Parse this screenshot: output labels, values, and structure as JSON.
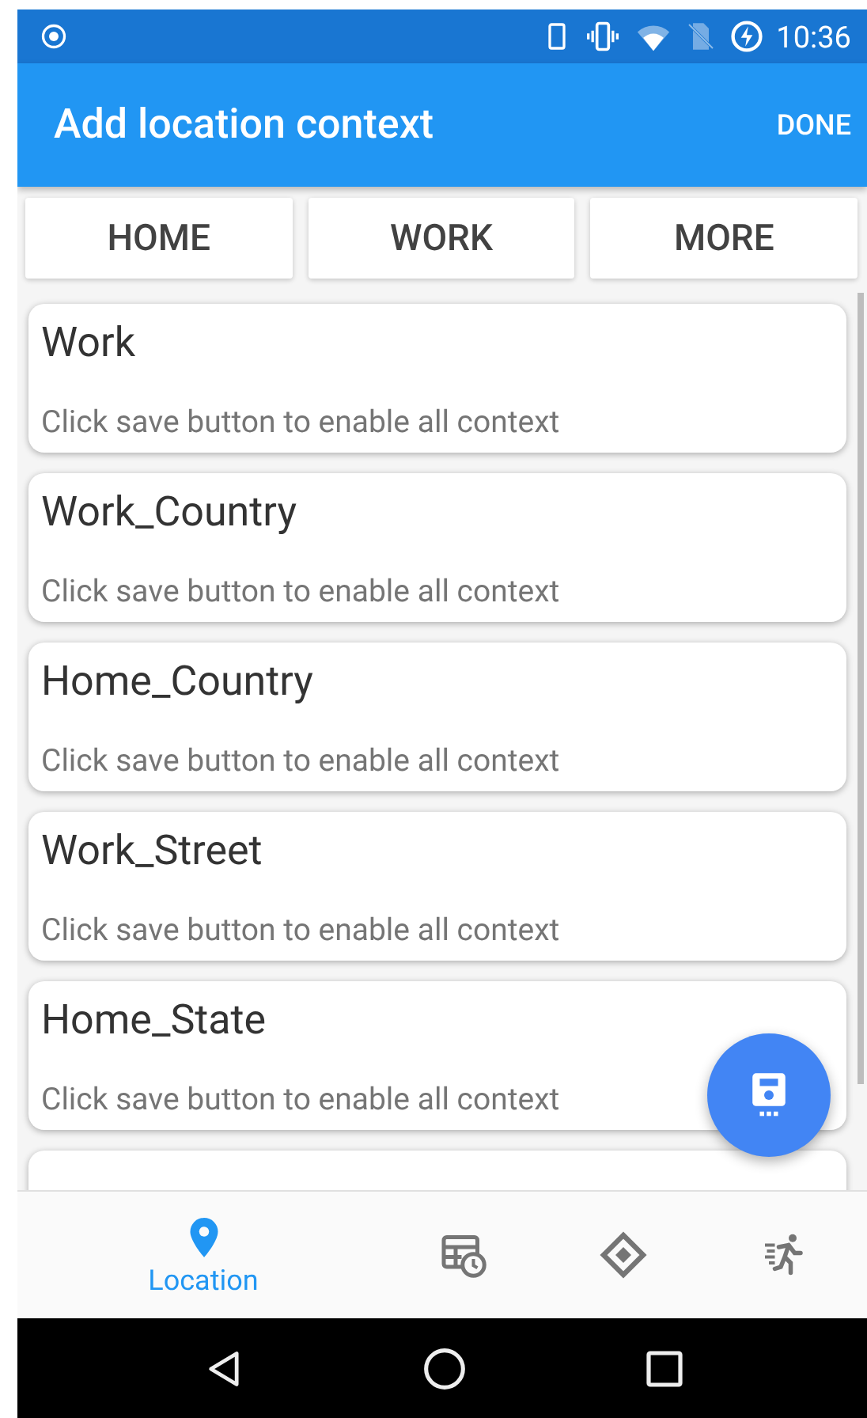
{
  "status_bar": {
    "time": "10:36"
  },
  "app_bar": {
    "title": "Add location context",
    "action": "DONE"
  },
  "filter_buttons": [
    "HOME",
    "WORK",
    "MORE"
  ],
  "cards": [
    {
      "title": "Work",
      "subtitle": "Click save button to enable all context"
    },
    {
      "title": "Work_Country",
      "subtitle": "Click save button to enable all context"
    },
    {
      "title": "Home_Country",
      "subtitle": "Click save button to enable all context"
    },
    {
      "title": "Work_Street",
      "subtitle": "Click save button to enable all context"
    },
    {
      "title": "Home_State",
      "subtitle": "Click save button to enable all context"
    }
  ],
  "bottom_nav": [
    {
      "label": "Location",
      "selected": true
    },
    {
      "selected": false
    },
    {
      "selected": false
    },
    {
      "selected": false
    }
  ]
}
